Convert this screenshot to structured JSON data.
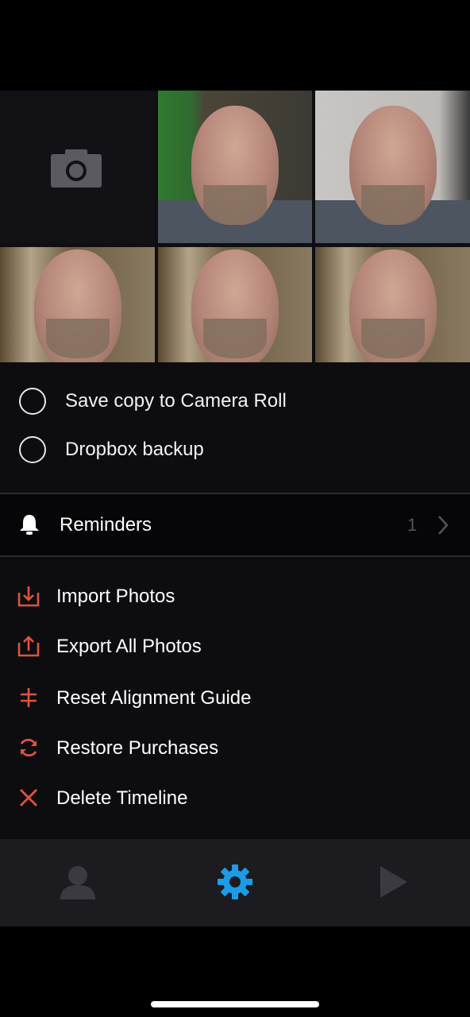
{
  "photo_grid": {
    "camera_icon": "camera-icon",
    "photo_count": 5
  },
  "options": {
    "save_copy_label": "Save copy to Camera Roll",
    "dropbox_label": "Dropbox backup"
  },
  "reminders": {
    "label": "Reminders",
    "count": "1",
    "icon": "bell-icon"
  },
  "actions": {
    "import_label": "Import Photos",
    "export_label": "Export All Photos",
    "reset_label": "Reset Alignment Guide",
    "restore_label": "Restore Purchases",
    "delete_label": "Delete Timeline"
  },
  "tabbar": {
    "tabs": [
      "profile-icon",
      "gear-icon",
      "play-icon"
    ],
    "active_tab": "gear-icon"
  },
  "colors": {
    "accent_red": "#e0523e",
    "active_tab_blue": "#1e9be6",
    "inactive_tab": "#3a3a40"
  }
}
